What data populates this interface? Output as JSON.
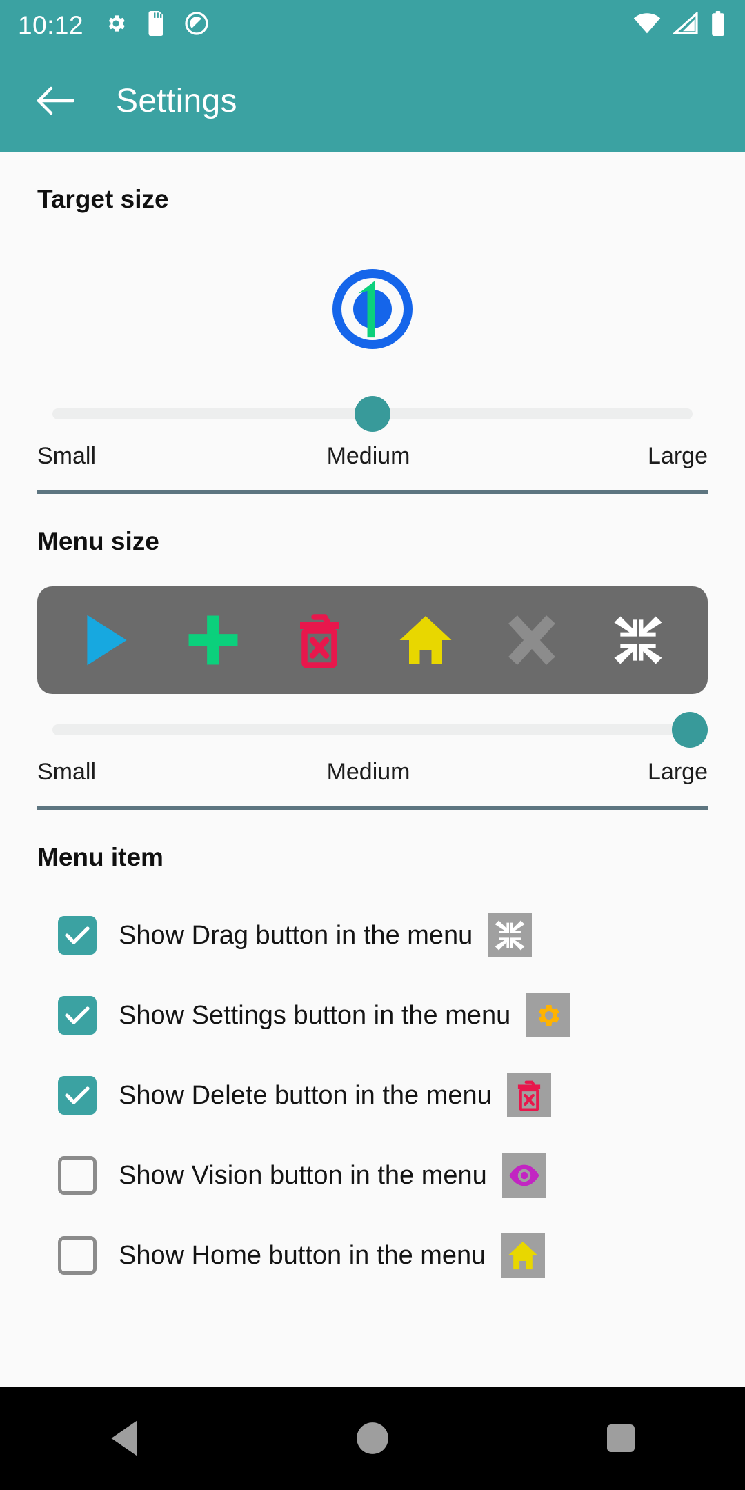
{
  "status_bar": {
    "time": "10:12",
    "left_icons": [
      "gear-icon",
      "sd-card-icon",
      "do-not-disturb-icon"
    ],
    "right_icons": [
      "wifi-icon",
      "cell-signal-icon",
      "battery-icon"
    ],
    "background_color": "#3ba2a2"
  },
  "app_bar": {
    "back_icon": "arrow-left-icon",
    "title": "Settings",
    "background_color": "#3ba2a2",
    "text_color": "#ffffff"
  },
  "sections": {
    "target_size": {
      "title": "Target size",
      "preview_icon": "target-ring-icon",
      "preview_colors": {
        "ring": "#1565ea",
        "mark": "#0bd07c"
      },
      "slider": {
        "labels": [
          "Small",
          "Medium",
          "Large"
        ],
        "value": "Medium",
        "position_percent": 50,
        "thumb_color": "#389a9a",
        "track_color": "#edeeee"
      }
    },
    "menu_size": {
      "title": "Menu size",
      "preview_background": "#6b6b6b",
      "preview_icons": [
        {
          "name": "play-icon",
          "color": "#17a8e0"
        },
        {
          "name": "plus-icon",
          "color": "#0bd07c"
        },
        {
          "name": "delete-icon",
          "color": "#e8174c"
        },
        {
          "name": "home-icon",
          "color": "#e8d700"
        },
        {
          "name": "close-icon",
          "color": "#8c8c8c"
        },
        {
          "name": "drag-icon",
          "color": "#ffffff"
        }
      ],
      "slider": {
        "labels": [
          "Small",
          "Medium",
          "Large"
        ],
        "value": "Large",
        "position_percent": 100,
        "thumb_color": "#389a9a",
        "track_color": "#edeeee"
      }
    },
    "menu_item": {
      "title": "Menu item",
      "rows": [
        {
          "label": "Show Drag button in the menu",
          "checked": true,
          "icon": "drag-icon",
          "icon_color": "#ffffff"
        },
        {
          "label": "Show Settings button in the menu",
          "checked": true,
          "icon": "gear-icon",
          "icon_color": "#ffb300"
        },
        {
          "label": "Show Delete button in the menu",
          "checked": true,
          "icon": "delete-icon",
          "icon_color": "#e8174c"
        },
        {
          "label": "Show Vision button in the menu",
          "checked": false,
          "icon": "vision-icon",
          "icon_color": "#c225c2"
        },
        {
          "label": "Show Home button in the menu",
          "checked": false,
          "icon": "home-icon",
          "icon_color": "#e8d700"
        }
      ],
      "checkbox_on_color": "#3ba2a2",
      "icon_tile_color": "#a0a0a0"
    }
  },
  "nav_bar": {
    "background_color": "#000000",
    "buttons": [
      "back-nav-icon",
      "home-nav-icon",
      "recents-nav-icon"
    ]
  },
  "divider_color": "#5d7580"
}
